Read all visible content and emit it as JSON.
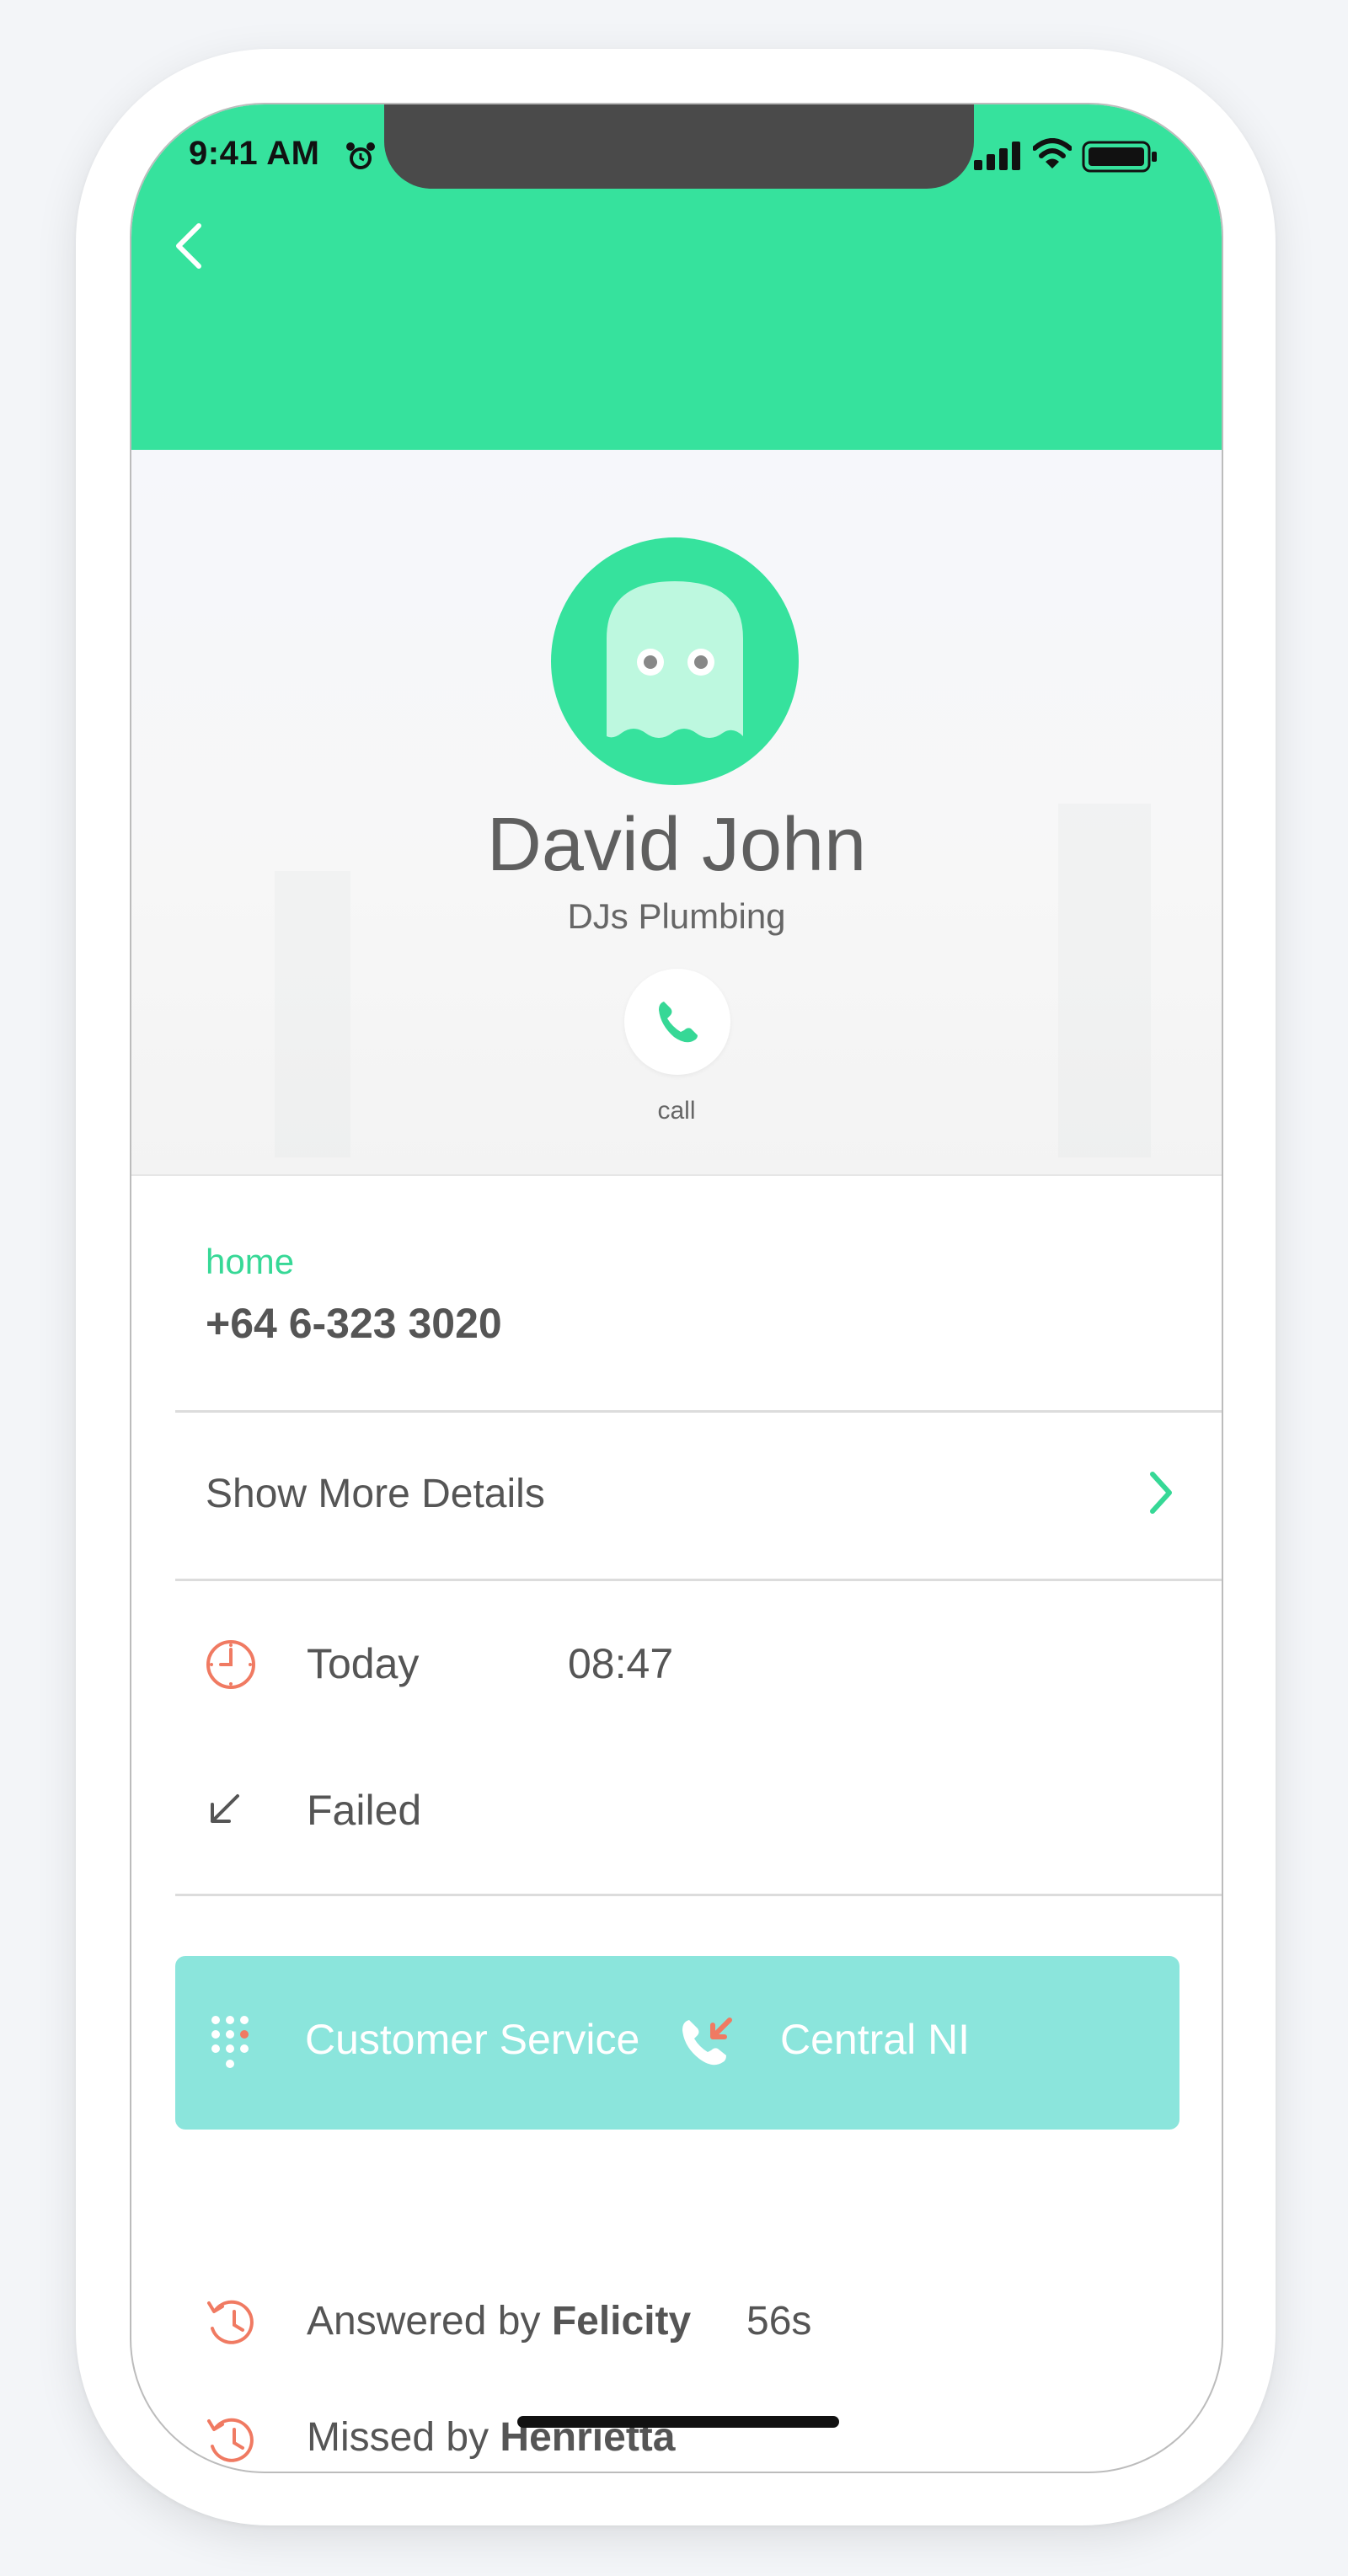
{
  "status_bar": {
    "time": "9:41 AM"
  },
  "contact": {
    "name": "David John",
    "company": "DJs Plumbing",
    "call_label": "call"
  },
  "phone": {
    "label": "home",
    "number": "+64 6-323 3020"
  },
  "more_details_label": "Show More Details",
  "call_info": {
    "date": "Today",
    "time": "08:47",
    "status": "Failed"
  },
  "routing": {
    "queue": "Customer Service",
    "location": "Central NI"
  },
  "history": [
    {
      "prefix": "Answered by",
      "agent": "Felicity",
      "duration": "56s"
    },
    {
      "prefix": "Missed by",
      "agent": "Henrietta",
      "duration": ""
    }
  ],
  "colors": {
    "accent": "#36e29d",
    "banner": "#8be5dc",
    "alert": "#f07a62"
  }
}
